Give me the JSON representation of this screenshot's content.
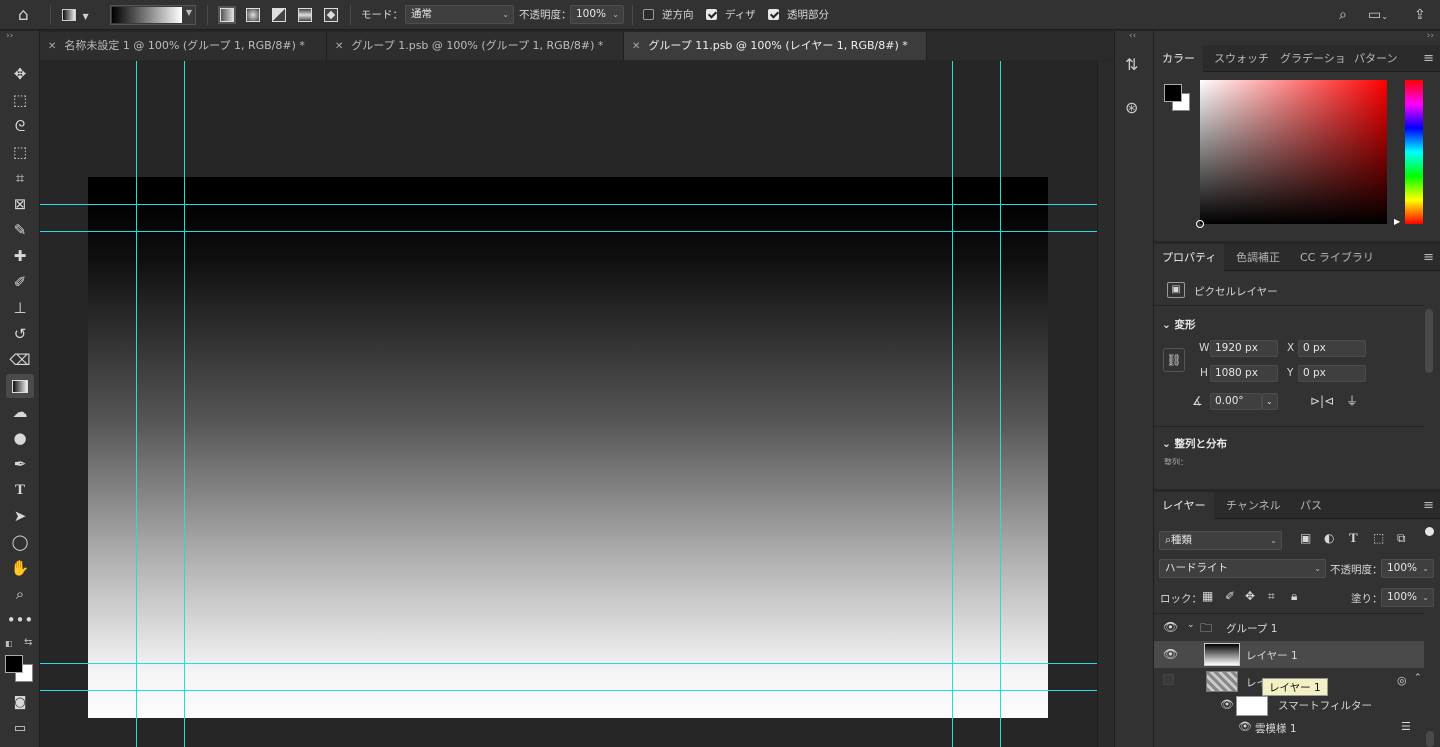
{
  "options_bar": {
    "mode_label": "モード：",
    "mode_value": "通常",
    "opacity_label": "不透明度：",
    "opacity_value": "100%",
    "reverse_label": "逆方向",
    "dither_label": "ディザ",
    "transparency_label": "透明部分",
    "reverse_checked": false,
    "dither_checked": true,
    "transparency_checked": true
  },
  "tabs": [
    {
      "label": "名称未設定 1 @ 100% (グループ 1, RGB/8#) *",
      "active": false
    },
    {
      "label": "グループ 1.psb @ 100% (グループ 1, RGB/8#) *",
      "active": false
    },
    {
      "label": "グループ 11.psb @ 100% (レイヤー 1, RGB/8#) *",
      "active": true
    }
  ],
  "tools": [
    "move-icon",
    "marquee-icon",
    "lasso-icon",
    "object-select-icon",
    "crop-icon",
    "frame-icon",
    "eyedropper-icon",
    "healing-icon",
    "brush-icon",
    "stamp-icon",
    "history-brush-icon",
    "eraser-icon",
    "gradient-icon",
    "blur-icon",
    "dodge-icon",
    "pen-icon",
    "type-icon",
    "path-select-icon",
    "ellipse-icon",
    "hand-icon",
    "zoom-icon",
    "more-icon"
  ],
  "color_panel": {
    "tabs": [
      "カラー",
      "スウォッチ",
      "グラデーショ",
      "パターン"
    ],
    "hue_color": "#ff0000"
  },
  "properties_panel": {
    "tabs": [
      "プロパティ",
      "色調補正",
      "CC ライブラリ"
    ],
    "layer_type": "ピクセルレイヤー",
    "transform_title": "変形",
    "w_label": "W",
    "w_value": "1920 px",
    "h_label": "H",
    "h_value": "1080 px",
    "x_label": "X",
    "x_value": "0 px",
    "y_label": "Y",
    "y_value": "0 px",
    "angle_value": "0.00°",
    "align_title": "整列と分布",
    "align_sub": "整列："
  },
  "layers_panel": {
    "tabs": [
      "レイヤー",
      "チャンネル",
      "パス"
    ],
    "filter_label": "種類",
    "blend_mode": "ハードライト",
    "opacity_label": "不透明度：",
    "opacity_value": "100%",
    "lock_label": "ロック：",
    "fill_label": "塗り：",
    "fill_value": "100%",
    "group_name": "グループ 1",
    "layer1_name": "レイヤー 1",
    "layer2_name": "レイ",
    "smart_filter": "スマートフィルター",
    "cloud_filter": "雲模様 1",
    "tooltip": "レイヤー 1"
  },
  "guides": {
    "color": "#1ee0e0"
  }
}
